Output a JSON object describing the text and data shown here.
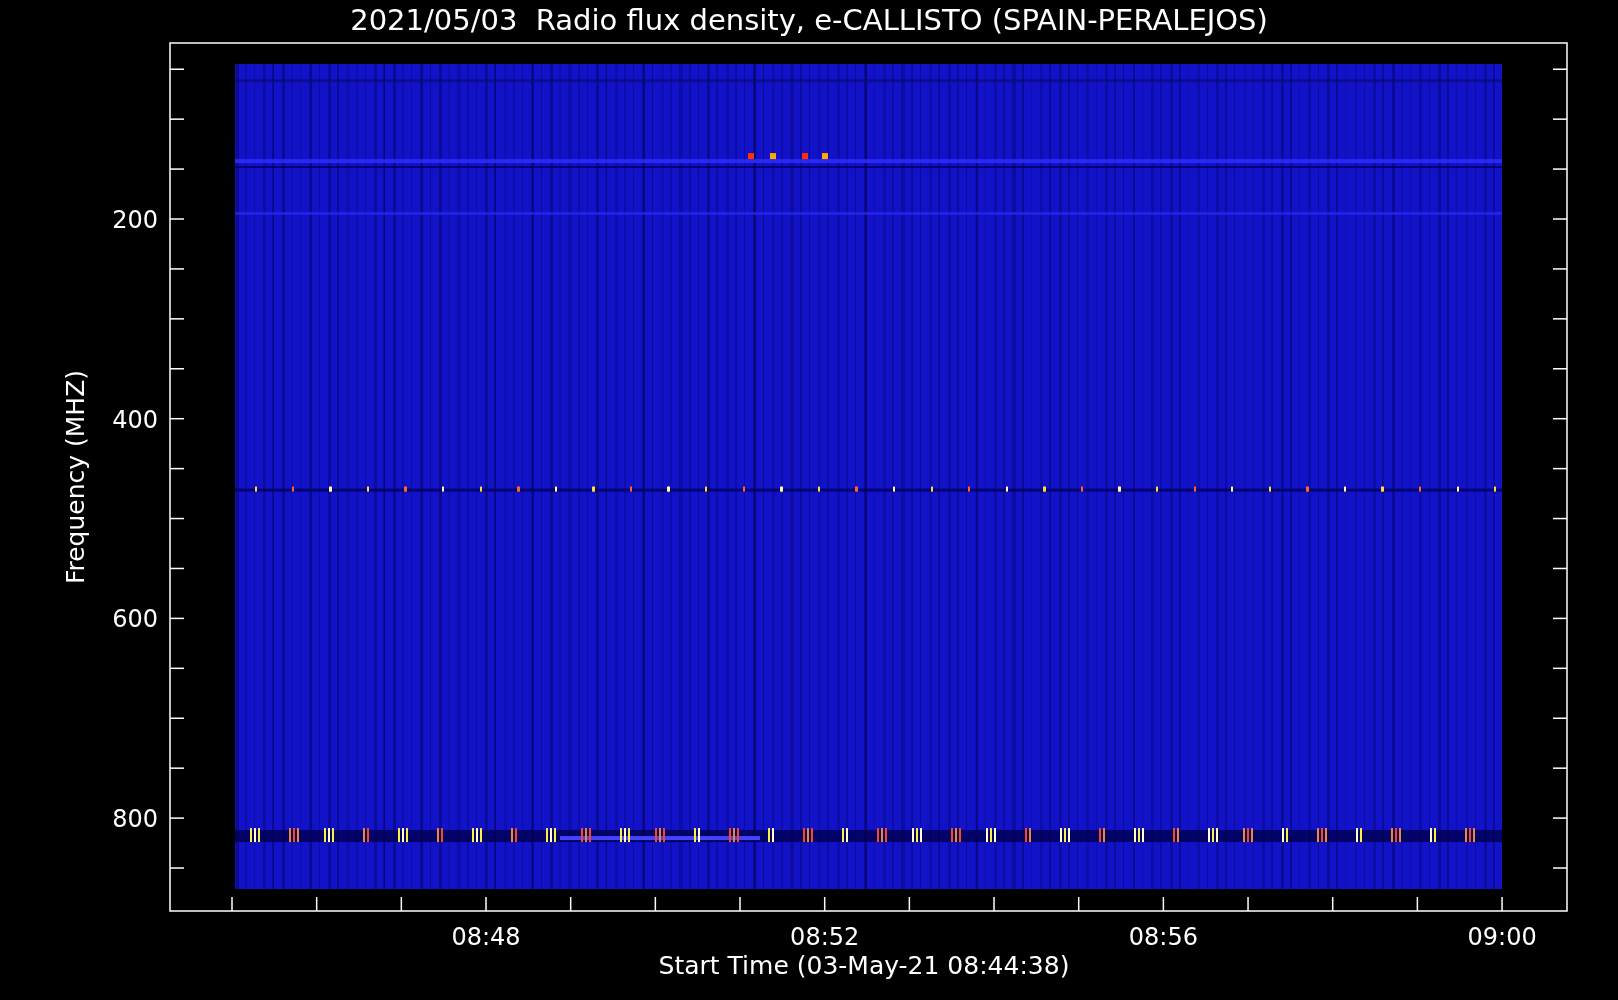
{
  "title": "2021/05/03  Radio flux density, e-CALLISTO (SPAIN-PERALEJOS)",
  "y_axis": {
    "label": "Frequency (MHZ)",
    "ticks": [
      "200",
      "400",
      "600",
      "800"
    ]
  },
  "x_axis": {
    "label": "Start Time (03-May-21 08:44:38)",
    "ticks": [
      "08:48",
      "08:52",
      "08:56",
      "09:00"
    ]
  }
}
